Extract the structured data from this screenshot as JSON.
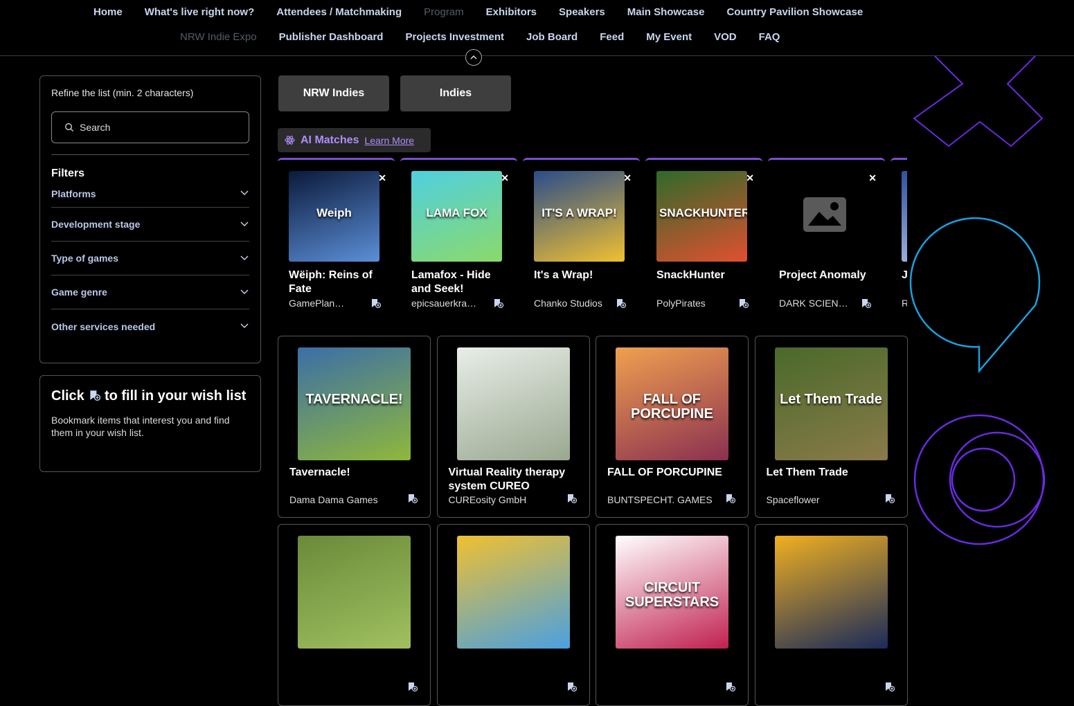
{
  "nav": {
    "row1": [
      "Home",
      "What's live right now?",
      "Attendees / Matchmaking",
      "Program",
      "Exhibitors",
      "Speakers",
      "Main Showcase",
      "Country Pavilion Showcase"
    ],
    "row1_dim": [
      false,
      false,
      false,
      true,
      false,
      false,
      false,
      false
    ],
    "row2": [
      "NRW Indie Expo",
      "Publisher Dashboard",
      "Projects Investment",
      "Job Board",
      "Feed",
      "My Event",
      "VOD",
      "FAQ"
    ],
    "row2_dim": [
      true,
      false,
      false,
      false,
      false,
      false,
      false,
      false
    ]
  },
  "filters": {
    "refine_label": "Refine the list (min. 2 characters)",
    "search_placeholder": "Search",
    "title": "Filters",
    "items": [
      "Platforms",
      "Development stage",
      "Type of games",
      "Game genre",
      "Other services needed"
    ]
  },
  "wishlist": {
    "title_before": "Click",
    "title_after": "to fill in your wish list",
    "description": "Bookmark items that interest you and find them in your wish list."
  },
  "tabs": [
    "NRW Indies",
    "Indies"
  ],
  "ai_matches": {
    "title": "AI Matches",
    "link": "Learn More",
    "cards": [
      {
        "name": "Wëiph: Reins of Fate",
        "studio": "GamePlan…",
        "thumb_colors": [
          "#0b1a3a",
          "#5c8fd8"
        ],
        "thumb_text": "Weiph"
      },
      {
        "name": "Lamafox - Hide and Seek!",
        "studio": "epicsauerkrau…",
        "thumb_colors": [
          "#4fd0e0",
          "#8bd96a"
        ],
        "thumb_text": "LAMA FOX"
      },
      {
        "name": "It's a Wrap!",
        "studio": "Chanko Studios",
        "thumb_colors": [
          "#2a4c8a",
          "#f0c030"
        ],
        "thumb_text": "IT'S A WRAP!"
      },
      {
        "name": "SnackHunter",
        "studio": "PolyPirates",
        "thumb_colors": [
          "#2e6a2a",
          "#e05030"
        ],
        "thumb_text": "SNACKHUNTER"
      },
      {
        "name": "Project Anomaly",
        "studio": "DARK SCIENCE",
        "thumb_colors": [
          "#000000",
          "#000000"
        ],
        "thumb_text": ""
      },
      {
        "name": "J C",
        "studio": "R",
        "thumb_colors": [
          "#3050a0",
          "#c0d0f0"
        ],
        "thumb_text": ""
      }
    ]
  },
  "games": [
    {
      "name": "Tavernacle!",
      "studio": "Dama Dama Games",
      "thumb_colors": [
        "#3b6ea8",
        "#8fb83a"
      ],
      "thumb_text": "TAVERNACLE!"
    },
    {
      "name": "Virtual Reality therapy system CUREO",
      "studio": "CUREosity GmbH",
      "thumb_colors": [
        "#e8eee8",
        "#9aa890"
      ],
      "thumb_text": ""
    },
    {
      "name": "FALL OF PORCUPINE",
      "studio": "BUNTSPECHT. GAMES",
      "thumb_colors": [
        "#f0a050",
        "#8a3050"
      ],
      "thumb_text": "FALL OF PORCUPINE"
    },
    {
      "name": "Let Them Trade",
      "studio": "Spaceflower",
      "thumb_colors": [
        "#4a6a2a",
        "#8a7a4a"
      ],
      "thumb_text": "Let Them Trade"
    },
    {
      "name": "",
      "studio": "",
      "thumb_colors": [
        "#6a8a3a",
        "#a0c060"
      ],
      "thumb_text": ""
    },
    {
      "name": "",
      "studio": "",
      "thumb_colors": [
        "#f0c030",
        "#4aa0e0"
      ],
      "thumb_text": ""
    },
    {
      "name": "",
      "studio": "",
      "thumb_colors": [
        "#ffffff",
        "#c02050"
      ],
      "thumb_text": "CIRCUIT SUPERSTARS"
    },
    {
      "name": "",
      "studio": "",
      "thumb_colors": [
        "#f0b020",
        "#1a2a5a"
      ],
      "thumb_text": ""
    }
  ],
  "colors": {
    "accent_purple": "#7a4fd0",
    "nav_text": "#c9d6ee",
    "deco_blue": "#1aa0e0",
    "deco_purple": "#6a2ae0"
  }
}
